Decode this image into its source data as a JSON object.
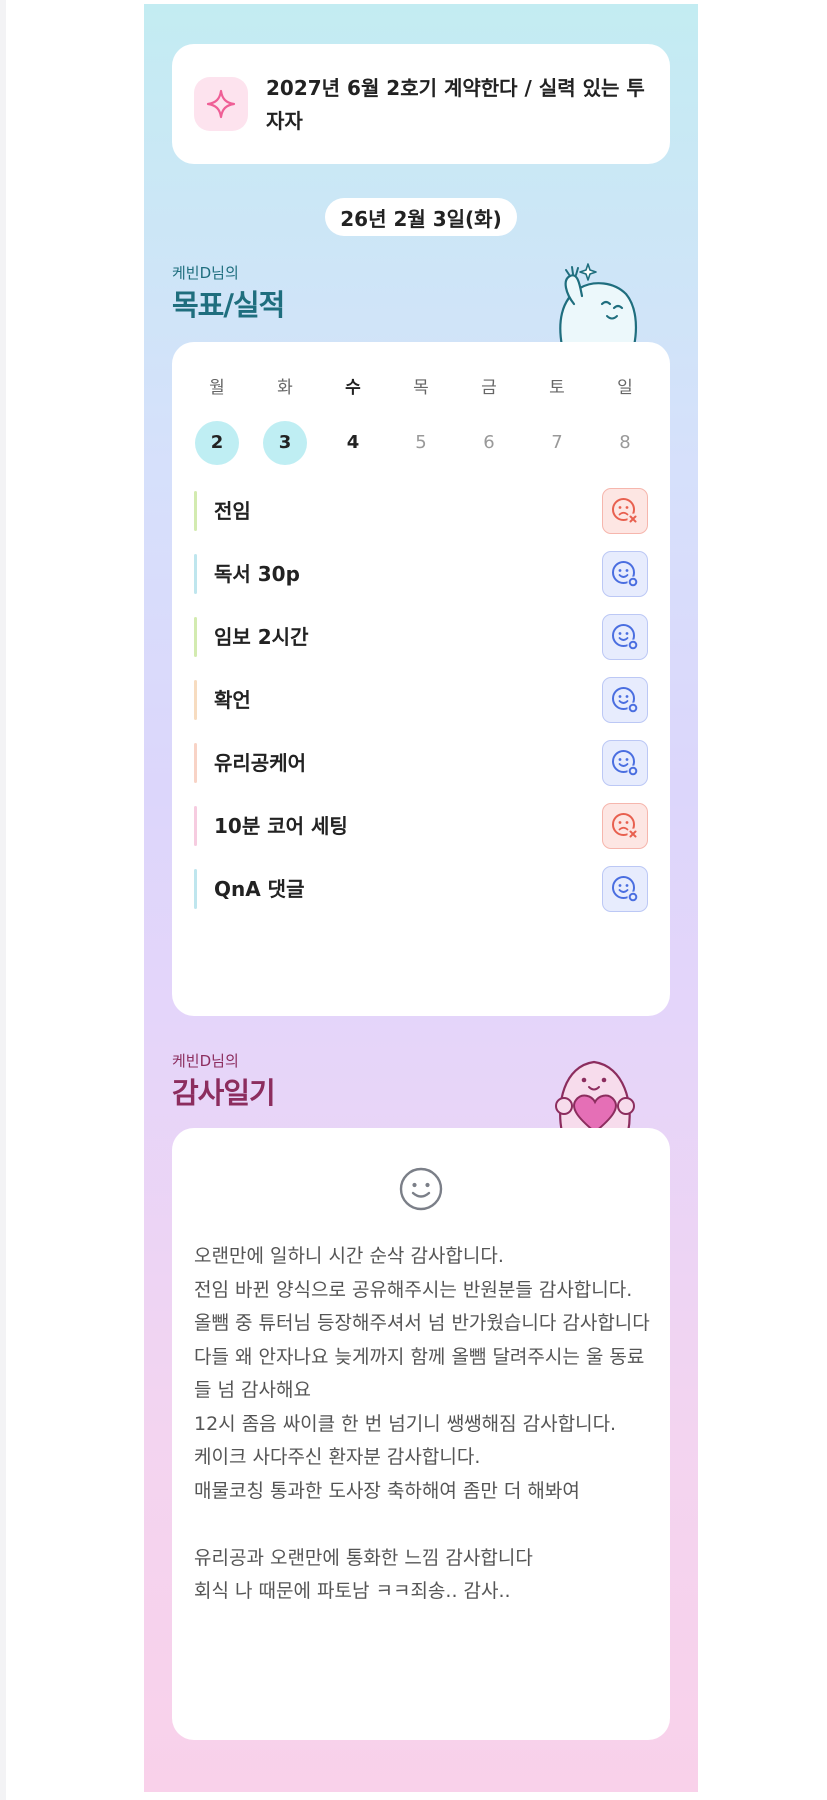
{
  "goal": {
    "text": "2027년 6월 2호기 계약한다 / 실력 있는 투자자",
    "icon": "sparkle-icon"
  },
  "date": "26년 2월 3일(화)",
  "goals_section": {
    "subtitle": "케빈D님의",
    "title": "목표/실적"
  },
  "week": {
    "days": [
      {
        "label": "월",
        "num": "2",
        "state": "done"
      },
      {
        "label": "화",
        "num": "3",
        "state": "done"
      },
      {
        "label": "수",
        "num": "4",
        "state": "current"
      },
      {
        "label": "목",
        "num": "5",
        "state": "future"
      },
      {
        "label": "금",
        "num": "6",
        "state": "future"
      },
      {
        "label": "토",
        "num": "7",
        "state": "future"
      },
      {
        "label": "일",
        "num": "8",
        "state": "future"
      }
    ]
  },
  "tasks": [
    {
      "name": "전임",
      "status": "fail",
      "color": "#d3ebb0"
    },
    {
      "name": "독서 30p",
      "status": "ok",
      "color": "#bfe6ee"
    },
    {
      "name": "임보 2시간",
      "status": "ok",
      "color": "#d3ebb0"
    },
    {
      "name": "확언",
      "status": "ok",
      "color": "#f7dcc0"
    },
    {
      "name": "유리공케어",
      "status": "ok",
      "color": "#f8d3c6"
    },
    {
      "name": "10분 코어 세팅",
      "status": "fail",
      "color": "#f6cce0"
    },
    {
      "name": "QnA 댓글",
      "status": "ok",
      "color": "#bfe6ee"
    }
  ],
  "diary_section": {
    "subtitle": "케빈D님의",
    "title": "감사일기"
  },
  "diary": {
    "text": "오랜만에 일하니 시간 순삭 감사합니다.\n전임 바뀐 양식으로 공유해주시는 반원분들 감사합니다.\n올뺌 중 튜터님 등장해주셔서 넘 반가웠습니다 감사합니다\n다들 왜 안자나요 늦게까지 함께 올뺌 달려주시는 울 동료들 넘 감사해요\n12시 좀음 싸이클 한 번 넘기니 쌩쌩해짐 감사합니다.\n케이크 사다주신 환자분 감사합니다.\n매물코칭 통과한 도사장 축하해여 좀만 더 해봐여\n\n유리공과 오랜만에 통화한 느낌 감사합니다\n회식 나 때문에 파토남 ㅋㅋ죄송.. 감사..",
    "icon": "smile-icon"
  },
  "colors": {
    "goals_title": "#1f6e7e",
    "diary_title": "#8c2d5e",
    "fail": "#e8604f",
    "ok": "#4a6ee0"
  }
}
